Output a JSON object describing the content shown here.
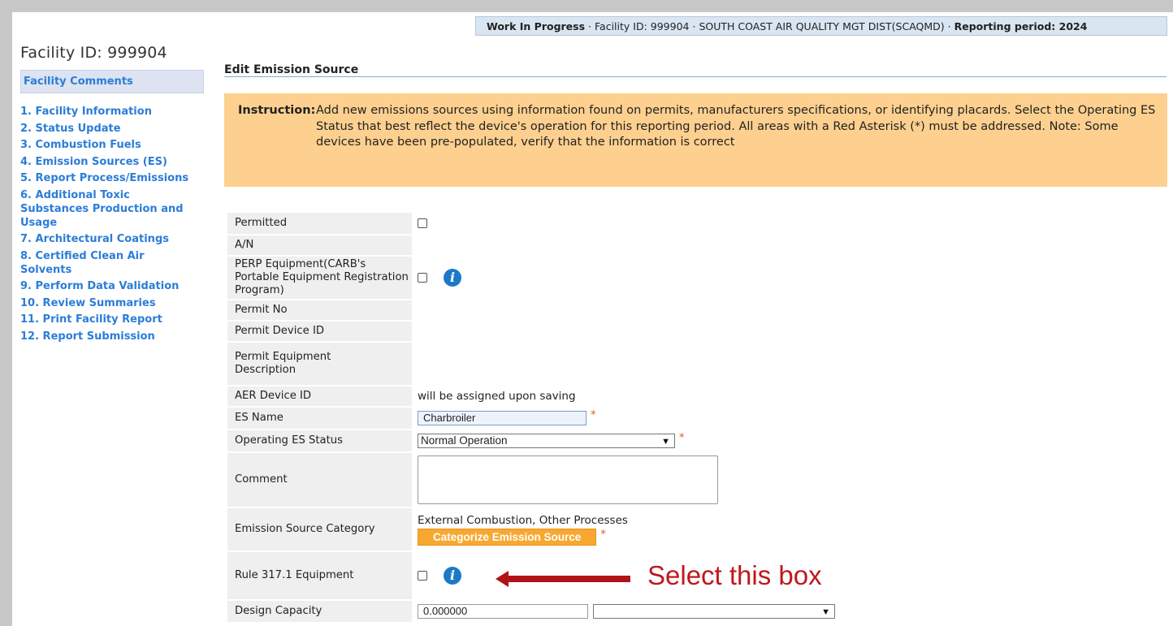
{
  "status_bar": {
    "label": "Work In Progress",
    "facility": "Facility ID: 999904",
    "district": "SOUTH COAST AIR QUALITY MGT DIST(SCAQMD)",
    "period_label": "Reporting period: 2024",
    "sep": "·"
  },
  "sidebar": {
    "title": "Facility ID: 999904",
    "comments": "Facility Comments",
    "items": [
      "1. Facility Information",
      "2. Status Update",
      "3. Combustion Fuels",
      "4. Emission Sources (ES)",
      "5. Report Process/Emissions",
      "6. Additional Toxic Substances Production and Usage",
      "7. Architectural Coatings",
      "8. Certified Clean Air Solvents",
      "9. Perform Data Validation",
      "10. Review Summaries",
      "11. Print Facility Report",
      "12. Report Submission"
    ]
  },
  "main": {
    "heading": "Edit Emission Source",
    "instruction_label": "Instruction:",
    "instruction_text": "Add new emissions sources using information found on permits, manufacturers specifications, or identifying placards. Select the Operating ES Status that best reflect the device's operation for this reporting period. All areas with a Red Asterisk (*) must be addressed. Note: Some devices have been pre-populated, verify that the information is correct"
  },
  "form": {
    "permitted": "Permitted",
    "an": "A/N",
    "perp": "PERP Equipment(CARB's Portable Equipment Registration Program)",
    "permit_no": "Permit No",
    "permit_device_id": "Permit Device ID",
    "permit_equipment_desc": "Permit Equipment Description",
    "aer_device_id": "AER Device ID",
    "aer_device_id_value": "will be assigned upon saving",
    "es_name": "ES Name",
    "es_name_value": "Charbroiler",
    "operating_status": "Operating ES Status",
    "operating_status_value": "Normal Operation",
    "comment": "Comment",
    "category": "Emission Source Category",
    "category_value": "External Combustion, Other Processes",
    "categorize_button": "Categorize Emission Source",
    "rule": "Rule 317.1 Equipment",
    "design_capacity": "Design Capacity",
    "design_capacity_value": "0.000000",
    "asterisk": "*"
  },
  "annotation": {
    "callout": "Select this box",
    "color": "#c0181c"
  }
}
